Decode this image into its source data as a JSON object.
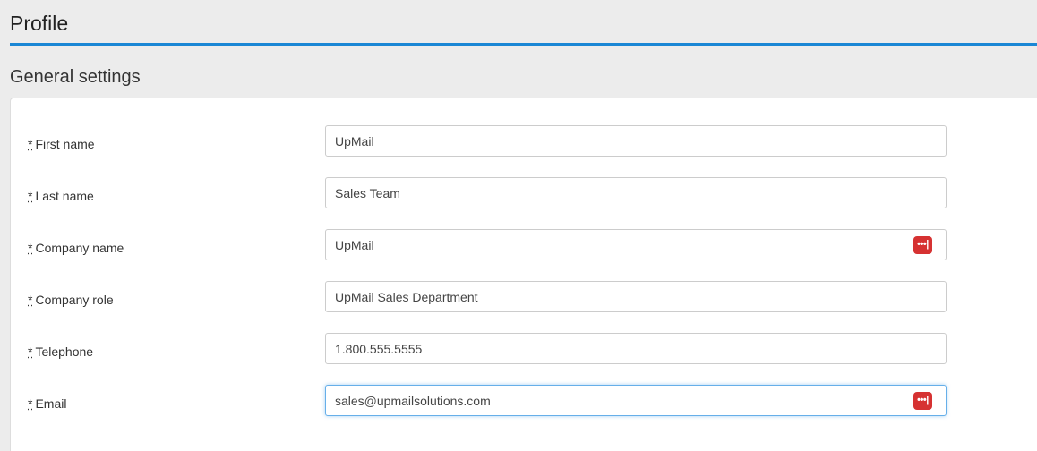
{
  "page": {
    "title": "Profile"
  },
  "section": {
    "title": "General settings"
  },
  "colors": {
    "accent": "#1a87d5",
    "password_manager_icon": "#d63232",
    "focus_border": "#66afe9"
  },
  "form": {
    "required_marker": "*",
    "fields": [
      {
        "label": "First name",
        "value": "UpMail",
        "has_pw_icon": false,
        "focused": false
      },
      {
        "label": "Last name",
        "value": "Sales Team",
        "has_pw_icon": false,
        "focused": false
      },
      {
        "label": "Company name",
        "value": "UpMail",
        "has_pw_icon": true,
        "focused": false
      },
      {
        "label": "Company role",
        "value": "UpMail Sales Department",
        "has_pw_icon": false,
        "focused": false
      },
      {
        "label": "Telephone",
        "value": "1.800.555.5555",
        "has_pw_icon": false,
        "focused": false
      },
      {
        "label": "Email",
        "value": "sales@upmailsolutions.com",
        "has_pw_icon": true,
        "focused": true
      }
    ]
  },
  "icons": {
    "password_manager": "password-manager-icon",
    "password_manager_glyph": "•••|"
  }
}
